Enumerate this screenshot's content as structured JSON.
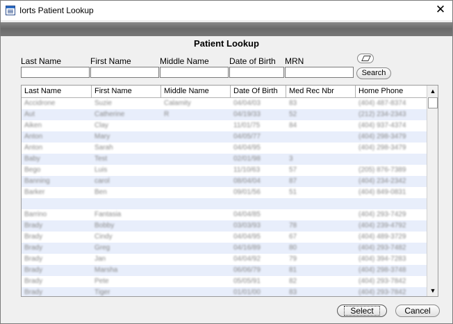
{
  "window": {
    "title": "Iorts Patient Lookup",
    "close_glyph": "✕"
  },
  "dialog": {
    "title": "Patient Lookup"
  },
  "search_form": {
    "last_name": {
      "label": "Last Name",
      "value": ""
    },
    "first_name": {
      "label": "First Name",
      "value": ""
    },
    "middle_name": {
      "label": "Middle Name",
      "value": ""
    },
    "date_of_birth": {
      "label": "Date of Birth",
      "value": ""
    },
    "mrn": {
      "label": "MRN",
      "value": ""
    },
    "clear_icon": "eraser-icon",
    "search_label": "Search"
  },
  "grid": {
    "columns": [
      "Last Name",
      "First Name",
      "Middle Name",
      "Date Of Birth",
      "Med Rec Nbr",
      "Home Phone"
    ],
    "rows": [
      [
        "Accidrone",
        "Suzie",
        "Calamity",
        "04/04/03",
        "83",
        "(404) 487-8374"
      ],
      [
        "Aut",
        "Catherine",
        "R",
        "04/19/33",
        "52",
        "(212) 234-2343"
      ],
      [
        "Aiken",
        "Clay",
        "",
        "11/01/75",
        "84",
        "(404) 937-4374"
      ],
      [
        "Anton",
        "Mary",
        "",
        "04/05/77",
        "",
        "(404) 298-3479"
      ],
      [
        "Anton",
        "Sarah",
        "",
        "04/04/95",
        "",
        "(404) 298-3479"
      ],
      [
        "Baby",
        "Test",
        "",
        "02/01/98",
        "3",
        ""
      ],
      [
        "Bego",
        "Luis",
        "",
        "11/10/63",
        "57",
        "(205) 876-7389"
      ],
      [
        "Banning",
        "carol",
        "",
        "08/04/04",
        "87",
        "(404) 234-2342"
      ],
      [
        "Barker",
        "Ben",
        "",
        "09/01/56",
        "51",
        "(404) 849-0831"
      ],
      [
        "",
        "",
        "",
        "",
        "",
        ""
      ],
      [
        "Barrino",
        "Fantasia",
        "",
        "04/04/85",
        "",
        "(404) 293-7429"
      ],
      [
        "Brady",
        "Bobby",
        "",
        "03/03/93",
        "78",
        "(404) 239-4792"
      ],
      [
        "Brady",
        "Cindy",
        "",
        "04/04/95",
        "67",
        "(404) 489-3729"
      ],
      [
        "Brady",
        "Greg",
        "",
        "04/16/89",
        "80",
        "(404) 293-7482"
      ],
      [
        "Brady",
        "Jan",
        "",
        "04/04/92",
        "79",
        "(404) 394-7283"
      ],
      [
        "Brady",
        "Marsha",
        "",
        "06/06/79",
        "81",
        "(404) 298-3748"
      ],
      [
        "Brady",
        "Pete",
        "",
        "05/05/91",
        "82",
        "(404) 293-7842"
      ],
      [
        "Brady",
        "Tiger",
        "",
        "01/01/00",
        "83",
        "(404) 293-7842"
      ]
    ]
  },
  "scrollbar": {
    "up_glyph": "▲",
    "down_glyph": "▼"
  },
  "actions": {
    "select_label": "Select",
    "cancel_label": "Cancel"
  }
}
